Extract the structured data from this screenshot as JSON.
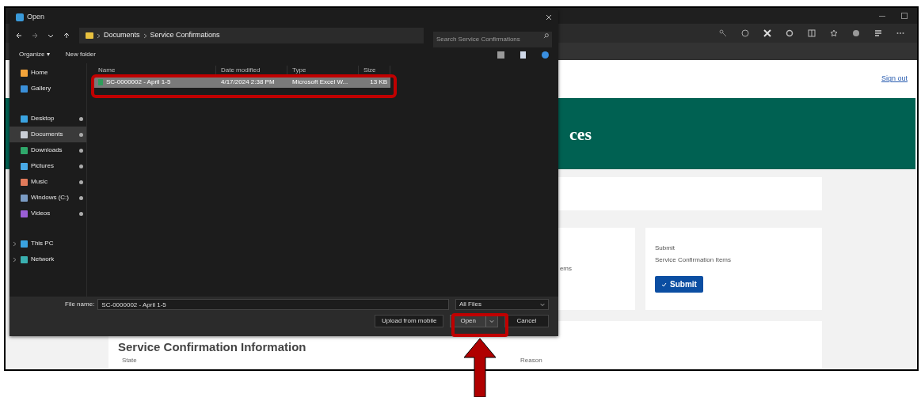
{
  "dialog": {
    "title": "Open",
    "breadcrumb": [
      "Documents",
      "Service Confirmations"
    ],
    "search_placeholder": "Search Service Confirmations",
    "toolbar": [
      "Organize ▾",
      "New folder"
    ],
    "sidebar": {
      "groups": [
        {
          "items": [
            {
              "label": "Home",
              "color": "#f2a33a",
              "pinned": false,
              "expandable": false,
              "selected": false
            },
            {
              "label": "Gallery",
              "color": "#3a8fd9",
              "pinned": false,
              "expandable": false,
              "selected": false
            }
          ]
        },
        {
          "items": [
            {
              "label": "Desktop",
              "color": "#3aa3e0",
              "pinned": true,
              "expandable": false,
              "selected": false
            },
            {
              "label": "Documents",
              "color": "#c9ced6",
              "pinned": true,
              "expandable": false,
              "selected": true
            },
            {
              "label": "Downloads",
              "color": "#2fa86b",
              "pinned": true,
              "expandable": false,
              "selected": false
            },
            {
              "label": "Pictures",
              "color": "#48a9e6",
              "pinned": true,
              "expandable": false,
              "selected": false
            },
            {
              "label": "Music",
              "color": "#e07a5a",
              "pinned": true,
              "expandable": false,
              "selected": false
            },
            {
              "label": "Windows (C:)",
              "color": "#7b9cc4",
              "pinned": true,
              "expandable": false,
              "selected": false
            },
            {
              "label": "Videos",
              "color": "#9b5fd6",
              "pinned": true,
              "expandable": false,
              "selected": false
            }
          ]
        },
        {
          "items": [
            {
              "label": "This PC",
              "color": "#3aa3e0",
              "pinned": false,
              "expandable": true,
              "selected": false
            },
            {
              "label": "Network",
              "color": "#3ab0b0",
              "pinned": false,
              "expandable": true,
              "selected": false
            }
          ]
        }
      ]
    },
    "columns": [
      "Name",
      "Date modified",
      "Type",
      "Size"
    ],
    "files": [
      {
        "cells": [
          "SC-0000002 - April 1-5",
          "4/17/2024 2:38 PM",
          "Microsoft Excel W...",
          "13 KB"
        ],
        "selected": true
      }
    ],
    "file_name_label": "File name:",
    "file_name": "SC-0000002 - April 1-5",
    "file_type": "All Files",
    "buttons": [
      "Upload from mobile",
      "Open",
      "Cancel"
    ]
  },
  "page": {
    "link": "Sign out",
    "banner_title": "ces",
    "card_text": "ems",
    "submit_card": {
      "title": "Submit",
      "description": "Service Confirmation Items",
      "button": "Submit"
    },
    "section_title": "Service Confirmation Information",
    "fields": [
      "State",
      "Reason"
    ]
  }
}
